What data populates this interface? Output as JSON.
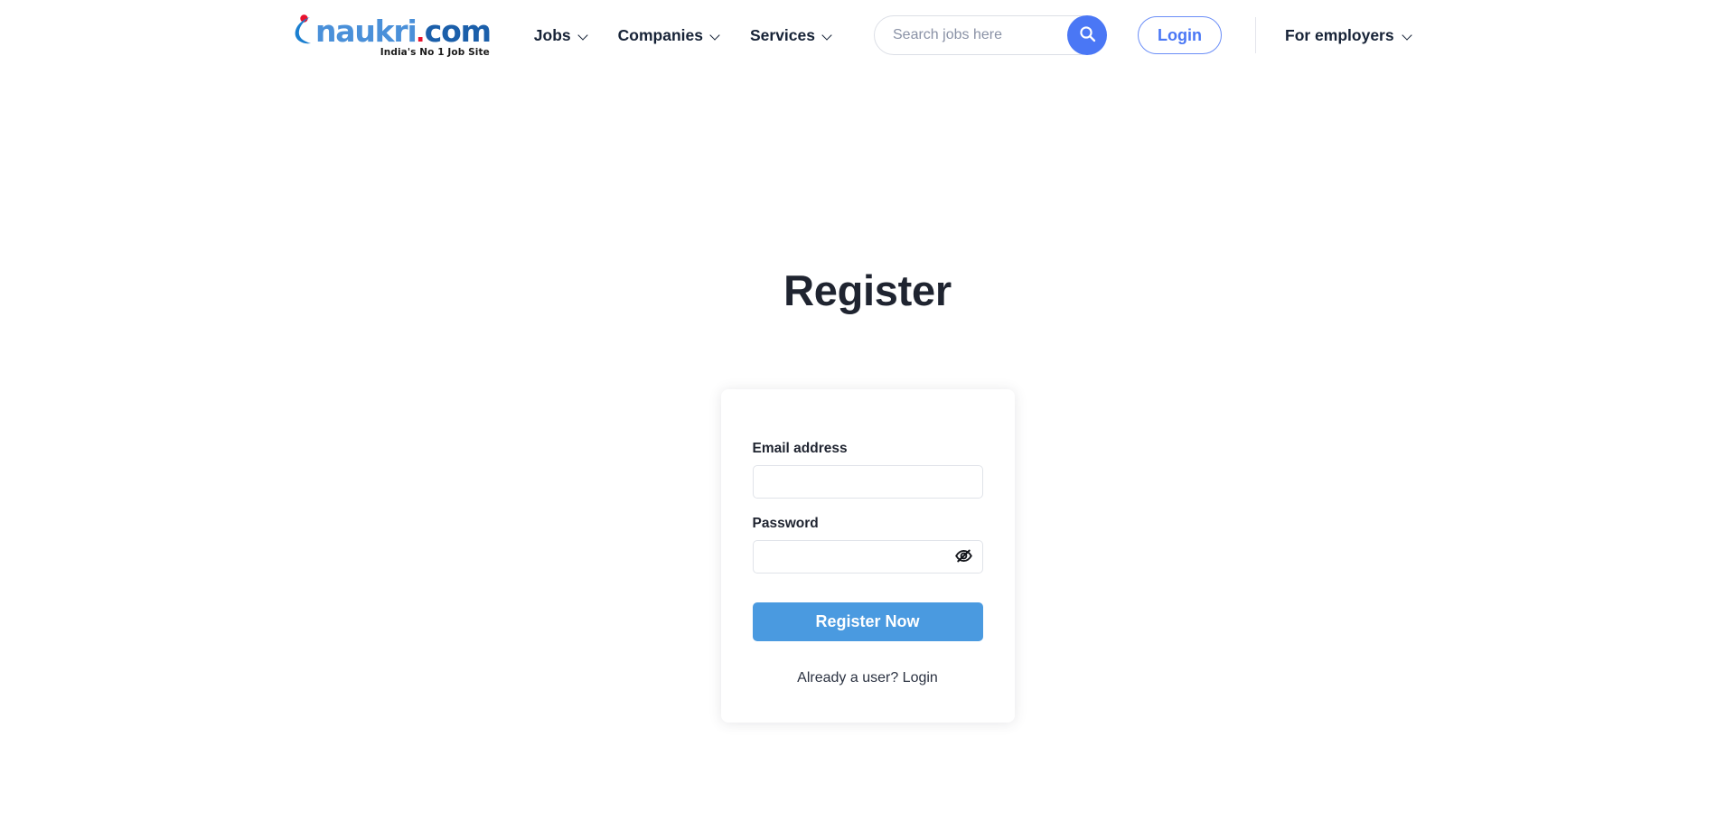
{
  "header": {
    "logo": {
      "word": "naukri",
      "dot": ".",
      "com": "com",
      "tagline": "India's No 1 Job Site",
      "swoosh_color": "#1b7fd0",
      "dot_color": "#e8112d",
      "word_color": "#4a90d9",
      "com_color": "#1b5faa"
    },
    "nav": [
      {
        "label": "Jobs",
        "icon": "chevron-down-icon"
      },
      {
        "label": "Companies",
        "icon": "chevron-down-icon"
      },
      {
        "label": "Services",
        "icon": "chevron-down-icon"
      }
    ],
    "search": {
      "placeholder": "Search jobs here",
      "value": "",
      "button_icon": "search-icon",
      "button_color": "#4a77f5"
    },
    "login_label": "Login",
    "login_color": "#4a77f5",
    "employers": {
      "label": "For employers",
      "icon": "chevron-down-icon"
    }
  },
  "main": {
    "title": "Register",
    "form": {
      "email": {
        "label": "Email address",
        "value": "",
        "placeholder": ""
      },
      "password": {
        "label": "Password",
        "value": "",
        "placeholder": "",
        "toggle_icon": "eye-off-icon"
      },
      "submit_label": "Register Now",
      "submit_color": "#4a9ae0",
      "footer_text": "Already a user? Login"
    }
  }
}
